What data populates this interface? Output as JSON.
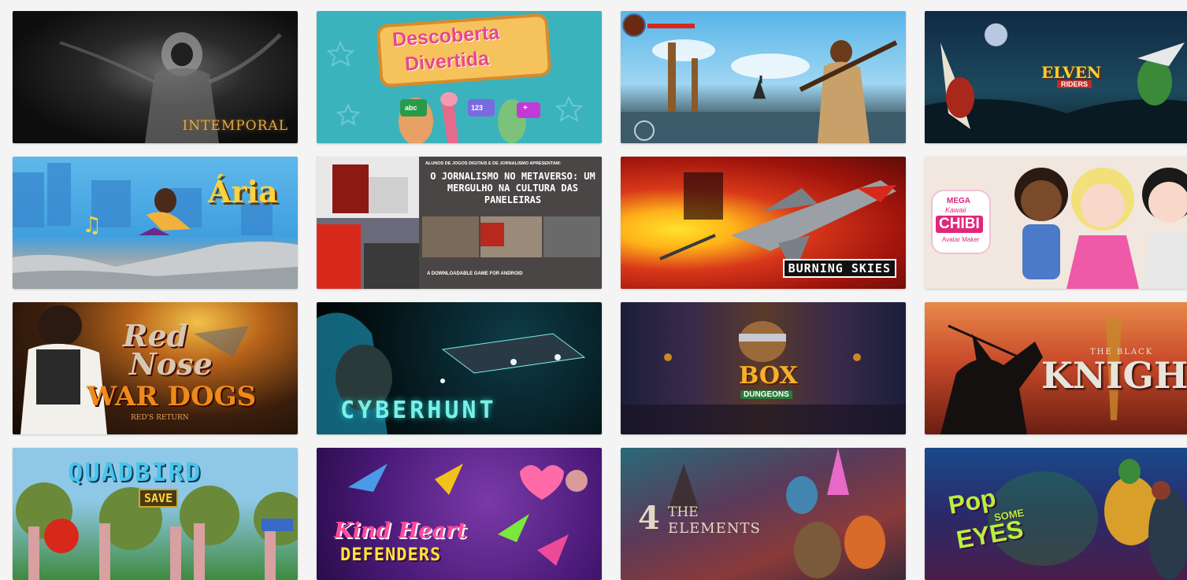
{
  "games": [
    {
      "id": "intemporal",
      "title": "INTEMPORAL"
    },
    {
      "id": "descoberta",
      "title_line1": "Descoberta",
      "title_line2": "Divertida",
      "tiles": [
        "abc",
        "123",
        "+"
      ]
    },
    {
      "id": "warrior",
      "title": ""
    },
    {
      "id": "elven",
      "title": "ELVEN",
      "subtitle": "RIDERS"
    },
    {
      "id": "aria",
      "title": "Ária"
    },
    {
      "id": "jornalismo",
      "credit": "ALUNOS DE JOGOS DIGITAIS E DE JORNALISMO APRESENTAM:",
      "headline": "O JORNALISMO NO METAVERSO: UM MERGULHO NA CULTURA DAS PANELEIRAS",
      "footer": "A DOWNLOADABLE GAME FOR ANDROID"
    },
    {
      "id": "burning",
      "title": "BURNING SKIES"
    },
    {
      "id": "chibi",
      "line1": "MEGA",
      "line2": "Kawaii",
      "line3": "CHIBI",
      "line4": "Avatar Maker"
    },
    {
      "id": "rednose",
      "line1": "Red",
      "line2": "Nose",
      "line3": "WAR DOGS",
      "line4": "RED'S RETURN"
    },
    {
      "id": "cyberhunt",
      "title": "CYBERHUNT"
    },
    {
      "id": "box",
      "title": "BOX",
      "subtitle": "DUNGEONS"
    },
    {
      "id": "knight",
      "small": "THE BLACK",
      "title": "KNIGHT"
    },
    {
      "id": "quadbird",
      "title": "QUADBIRD",
      "subtitle": "SAVE"
    },
    {
      "id": "kindheart",
      "line1": "Kind Heart",
      "line2": "DEFENDERS"
    },
    {
      "id": "elements",
      "numeral": "4",
      "line1": "THE",
      "line2": "ELEMENTS"
    },
    {
      "id": "popeyes",
      "line1": "Pop",
      "line2": "SOME",
      "line3": "EYES"
    }
  ],
  "colors": {
    "page_bg": "#f4f4f4",
    "descoberta_bg": "#3bb3bd",
    "burning_fire": "#ffb21a",
    "chibi_pink": "#e0287c"
  }
}
